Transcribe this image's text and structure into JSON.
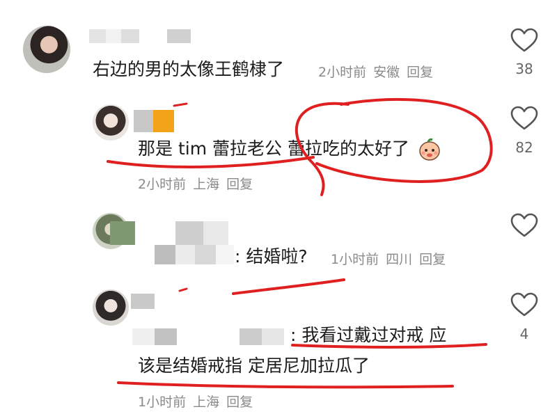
{
  "comments": [
    {
      "text": "右边的男的太像王鹤棣了",
      "time": "2小时前",
      "location": "安徽",
      "reply": "回复",
      "likes": "38"
    },
    {
      "text": "那是 tim  蕾拉老公  蕾拉吃的太好了",
      "emoji": "peach-face-emoji",
      "time": "2小时前",
      "location": "上海",
      "reply": "回复",
      "likes": "82"
    },
    {
      "text": ": 结婚啦?",
      "time": "1小时前",
      "location": "四川",
      "reply": "回复",
      "likes": ""
    },
    {
      "text_line1": ": 我看过戴过对戒  应",
      "text_line2": "该是结婚戒指  定居尼加拉瓜了",
      "time": "1小时前",
      "location": "上海",
      "reply": "回复",
      "likes": "4"
    }
  ],
  "icons": {
    "like": "heart-outline-icon"
  },
  "colors": {
    "annotation": "#e02020",
    "meta_text": "#8a8a8a"
  }
}
